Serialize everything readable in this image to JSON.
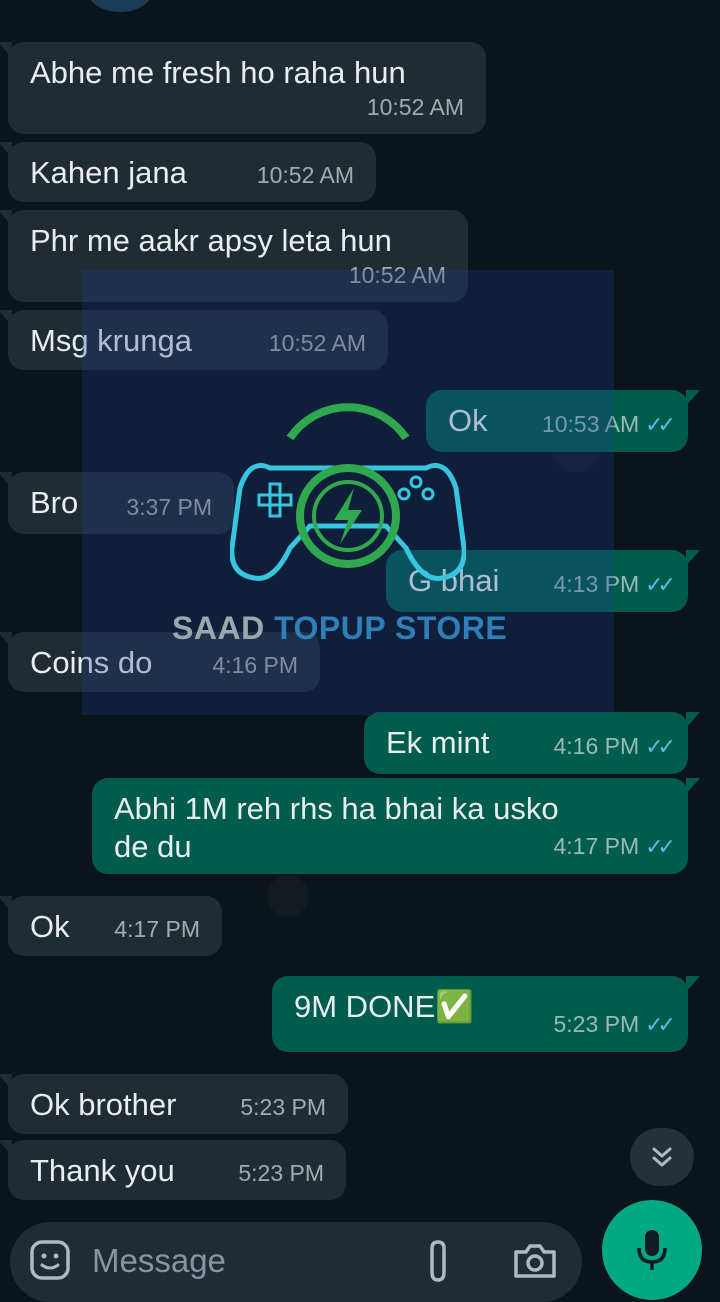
{
  "messages": [
    {
      "text": "Abhe me fresh ho raha hun",
      "time": "10:52 AM",
      "direction": "incoming"
    },
    {
      "text": "Kahen jana",
      "time": "10:52 AM",
      "direction": "incoming"
    },
    {
      "text": "Phr me aakr apsy leta hun",
      "time": "10:52 AM",
      "direction": "incoming"
    },
    {
      "text": "Msg krunga",
      "time": "10:52 AM",
      "direction": "incoming"
    },
    {
      "text": "Ok",
      "time": "10:53 AM",
      "direction": "outgoing"
    },
    {
      "text": "Bro",
      "time": "3:37 PM",
      "direction": "incoming"
    },
    {
      "text": "G bhai",
      "time": "4:13 PM",
      "direction": "outgoing"
    },
    {
      "text": "Coins do",
      "time": "4:16 PM",
      "direction": "incoming"
    },
    {
      "text": "Ek mint",
      "time": "4:16 PM",
      "direction": "outgoing"
    },
    {
      "text": "Abhi 1M reh rhs ha bhai ka usko\nde du",
      "time": "4:17 PM",
      "direction": "outgoing"
    },
    {
      "text": "Ok",
      "time": "4:17 PM",
      "direction": "incoming"
    },
    {
      "text": "9M DONE✅",
      "time": "5:23 PM",
      "direction": "outgoing"
    },
    {
      "text": "Ok brother",
      "time": "5:23 PM",
      "direction": "incoming"
    },
    {
      "text": "Thank you",
      "time": "5:23 PM",
      "direction": "incoming"
    }
  ],
  "watermark": {
    "word1": "SAAD",
    "word2": "TOPUP STORE"
  },
  "composer": {
    "placeholder": "Message"
  },
  "icons": {
    "emoji": "emoji-icon",
    "attach": "paperclip-icon",
    "camera": "camera-icon",
    "mic": "microphone-icon",
    "scroll": "chevron-double-down-icon",
    "read": "double-check-icon"
  },
  "colors": {
    "background": "#0b141a",
    "incoming_bubble": "#202c33",
    "outgoing_bubble": "#005c4b",
    "accent": "#00a884",
    "read_ticks": "#53bdeb"
  }
}
